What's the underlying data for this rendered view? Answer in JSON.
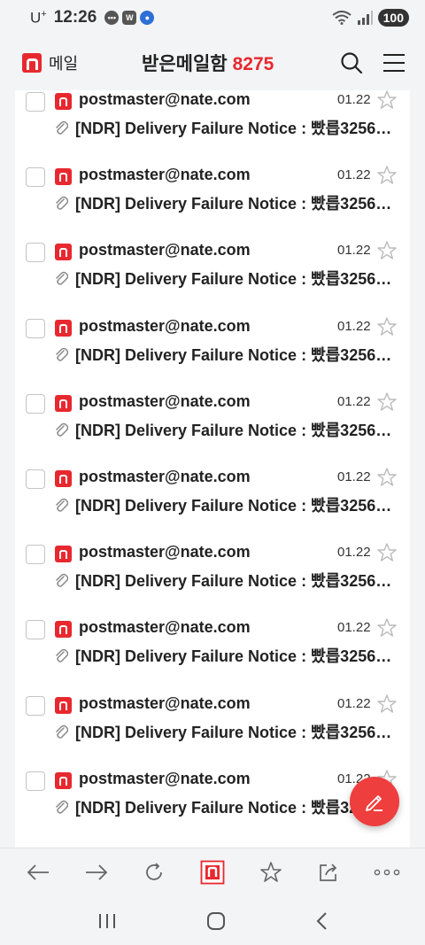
{
  "status": {
    "carrier": "U",
    "carrier_sup": "+",
    "time": "12:26",
    "battery": "100",
    "icons": [
      "chat-icon",
      "w-app-icon",
      "news-icon"
    ]
  },
  "header": {
    "brand": "메일",
    "title": "받은메일함",
    "count": "8275",
    "icons": [
      "search-icon",
      "menu-icon"
    ]
  },
  "colors": {
    "accent": "#e8282f",
    "fab": "#ef3e3e"
  },
  "mail": {
    "items": [
      {
        "sender": "postmaster@nate.com",
        "date": "01.22",
        "subject": "[NDR] Delivery Failure Notice : 빴릅3256-5..."
      },
      {
        "sender": "postmaster@nate.com",
        "date": "01.22",
        "subject": "[NDR] Delivery Failure Notice : 빴릅3256-5..."
      },
      {
        "sender": "postmaster@nate.com",
        "date": "01.22",
        "subject": "[NDR] Delivery Failure Notice : 빴릅3256-5..."
      },
      {
        "sender": "postmaster@nate.com",
        "date": "01.22",
        "subject": "[NDR] Delivery Failure Notice : 빴릅3256-5..."
      },
      {
        "sender": "postmaster@nate.com",
        "date": "01.22",
        "subject": "[NDR] Delivery Failure Notice : 빴릅3256-5..."
      },
      {
        "sender": "postmaster@nate.com",
        "date": "01.22",
        "subject": "[NDR] Delivery Failure Notice : 빴릅3256-5..."
      },
      {
        "sender": "postmaster@nate.com",
        "date": "01.22",
        "subject": "[NDR] Delivery Failure Notice : 빴릅3256-5..."
      },
      {
        "sender": "postmaster@nate.com",
        "date": "01.22",
        "subject": "[NDR] Delivery Failure Notice : 빴릅3256-5..."
      },
      {
        "sender": "postmaster@nate.com",
        "date": "01.22",
        "subject": "[NDR] Delivery Failure Notice : 빴릅3256-5..."
      },
      {
        "sender": "postmaster@nate.com",
        "date": "01.22",
        "subject": "[NDR] Delivery Failure Notice : 빴릅3256..."
      }
    ]
  },
  "toolbar": [
    "back-icon",
    "forward-icon",
    "refresh-icon",
    "nate-home-icon",
    "bookmark-star-icon",
    "share-icon",
    "more-icon"
  ],
  "navbar": [
    "recent-apps-icon",
    "home-icon",
    "back-nav-icon"
  ]
}
